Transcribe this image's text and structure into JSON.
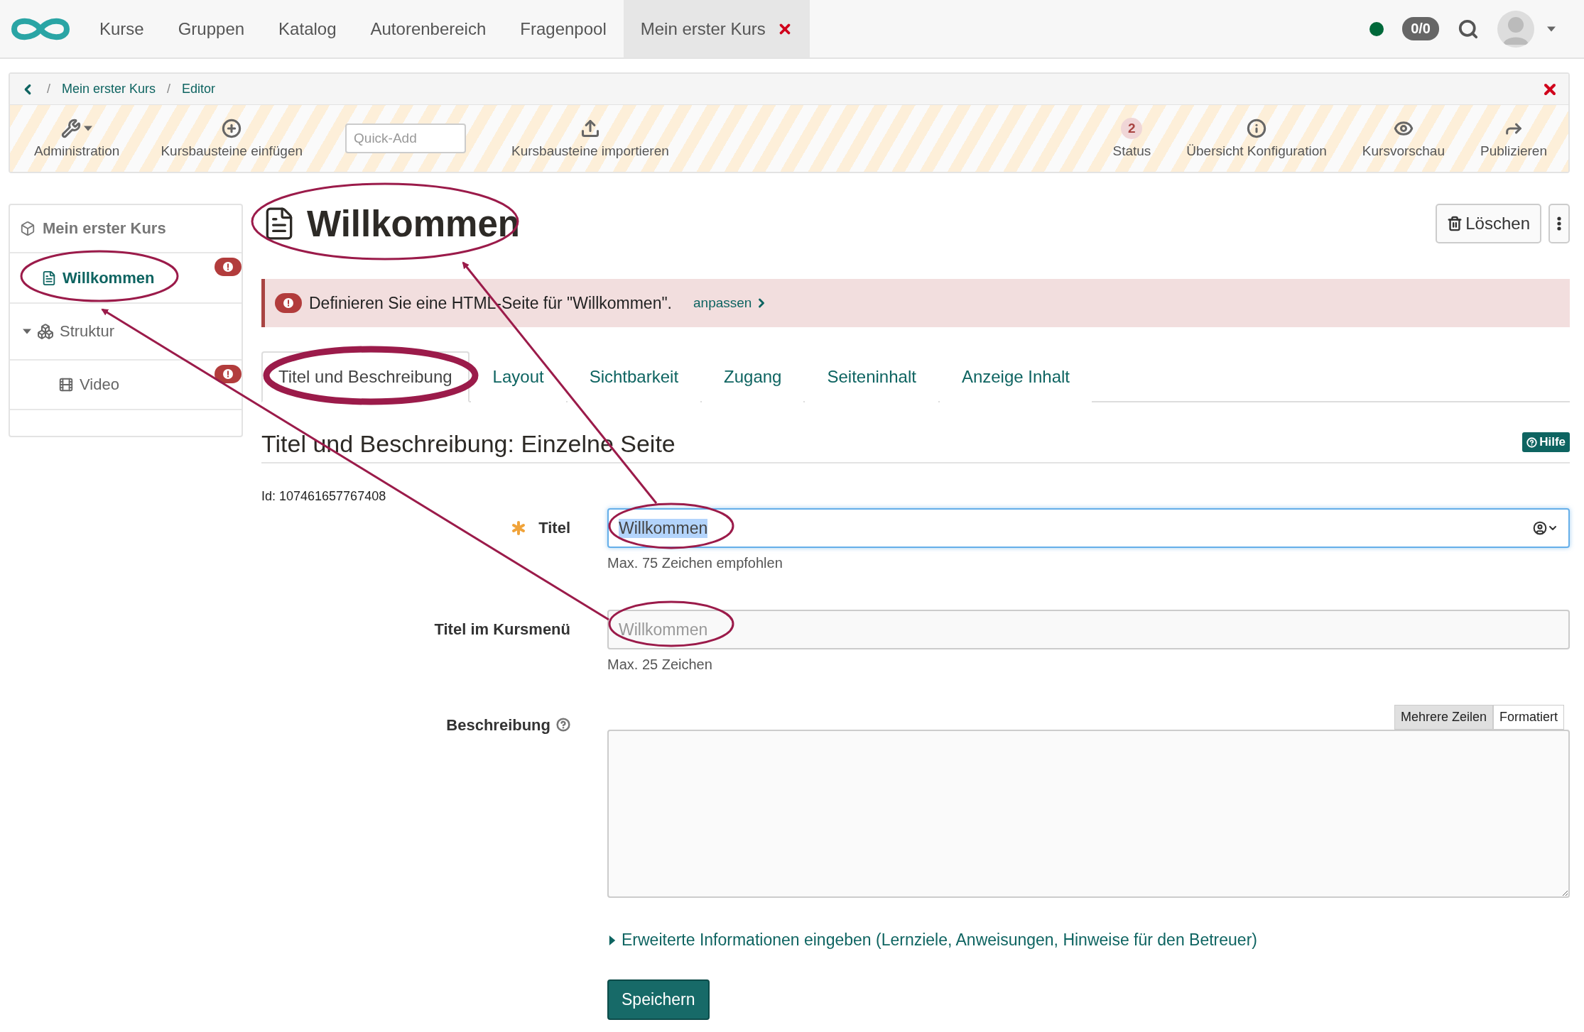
{
  "top_nav": {
    "items": [
      {
        "label": "Kurse",
        "selected": false,
        "closable": false
      },
      {
        "label": "Gruppen",
        "selected": false,
        "closable": false
      },
      {
        "label": "Katalog",
        "selected": false,
        "closable": false
      },
      {
        "label": "Autorenbereich",
        "selected": false,
        "closable": false
      },
      {
        "label": "Fragenpool",
        "selected": false,
        "closable": false
      },
      {
        "label": "Mein erster Kurs",
        "selected": true,
        "closable": true
      }
    ],
    "online": true,
    "counter": "0/0"
  },
  "breadcrumb": {
    "separator": "/",
    "items": [
      "Mein erster Kurs",
      "Editor"
    ]
  },
  "toolbar": {
    "left": [
      {
        "kind": "dropdown",
        "label": "Administration"
      },
      {
        "kind": "button",
        "label": "Kursbausteine einfügen"
      },
      {
        "kind": "input",
        "placeholder": "Quick-Add"
      },
      {
        "kind": "button",
        "label": "Kursbausteine importieren"
      }
    ],
    "right": [
      {
        "kind": "count",
        "count": "2",
        "label": "Status"
      },
      {
        "kind": "button",
        "label": "Übersicht Konfiguration"
      },
      {
        "kind": "button",
        "label": "Kursvorschau"
      },
      {
        "kind": "button",
        "label": "Publizieren"
      }
    ]
  },
  "sidebar": {
    "title": "Mein erster Kurs",
    "items": [
      {
        "kind": "page",
        "label": "Willkommen",
        "selected": true,
        "warning": true
      },
      {
        "kind": "structure",
        "label": "Struktur",
        "selected": false,
        "warning": false,
        "expanded": true,
        "children": [
          {
            "kind": "video",
            "label": "Video",
            "selected": false,
            "warning": true
          }
        ]
      }
    ]
  },
  "page": {
    "title": "Willkommen",
    "delete_button": "Löschen",
    "alert": {
      "text": "Definieren Sie eine HTML-Seite für \"Willkommen\".",
      "link": "anpassen"
    },
    "tabs": [
      {
        "label": "Titel und Beschreibung",
        "selected": true
      },
      {
        "label": "Layout",
        "selected": false
      },
      {
        "label": "Sichtbarkeit",
        "selected": false
      },
      {
        "label": "Zugang",
        "selected": false
      },
      {
        "label": "Seiteninhalt",
        "selected": false
      },
      {
        "label": "Anzeige Inhalt",
        "selected": false
      }
    ],
    "section_title": "Titel und Beschreibung: Einzelne Seite",
    "help": "Hilfe",
    "id_text": "Id: 107461657767408",
    "fields": [
      {
        "kind": "text",
        "label": "Titel",
        "required": true,
        "focused": true,
        "value": "Willkommen",
        "value_selected": true,
        "hint": "Max. 75 Zeichen empfohlen"
      },
      {
        "kind": "text",
        "label": "Titel im Kursmenü",
        "required": false,
        "focused": false,
        "placeholder": "Willkommen",
        "hint": "Max. 25 Zeichen"
      },
      {
        "kind": "textarea",
        "label": "Beschreibung",
        "help_icon": true,
        "modes": [
          {
            "label": "Mehrere Zeilen",
            "selected": true
          },
          {
            "label": "Formatiert",
            "selected": false
          }
        ]
      }
    ],
    "more_info": "Erweiterte Informationen eingeben (Lernziele, Anweisungen, Hinweise für den Betreuer)",
    "save_button": "Speichern"
  }
}
